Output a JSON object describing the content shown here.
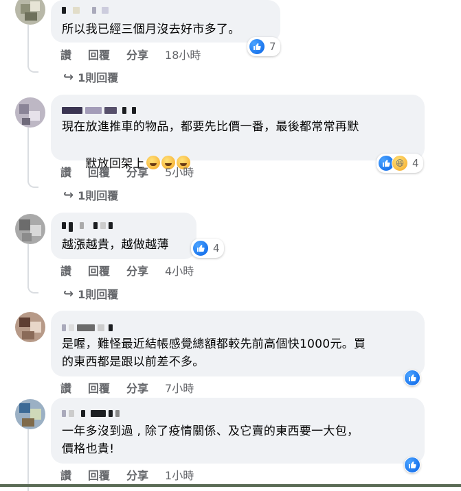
{
  "actions": {
    "like": "讚",
    "reply": "回覆",
    "share": "分享"
  },
  "comments": [
    {
      "text": "所以我已經三個月沒去好市多了。",
      "time": "18小時",
      "reactions": 7,
      "reply_link": "1則回覆",
      "reaction_types": [
        "like-icon"
      ]
    },
    {
      "text_line1": "現在放進推車的物品，都要先比價一番，最後都常常再默",
      "text_line2": "默放回架上",
      "time": "5小時",
      "reactions": 4,
      "reply_link": "1則回覆",
      "reaction_types": [
        "like-icon",
        "haha-icon"
      ],
      "inline_emoji": "rofl-emoji"
    },
    {
      "text": "越漲越貴，越做越薄",
      "time": "4小時",
      "reactions": 4,
      "reply_link": "1則回覆",
      "reaction_types": [
        "like-icon"
      ]
    },
    {
      "text_line1": "是喔，難怪最近結帳感覺總額都較先前高個快1000元。買",
      "text_line2": "的東西都是跟以前差不多。",
      "time": "7小時",
      "reaction_types": [
        "like-icon"
      ]
    },
    {
      "text_line1": "一年多沒到過 , 除了疫情關係、及它賣的東西要一大包，",
      "text_line2": "價格也貴!",
      "time": "1小時",
      "reaction_types": [
        "like-icon"
      ]
    }
  ],
  "colors": {
    "bubble": "#f0f2f5",
    "like_blue": "#1877f2",
    "meta_gray": "#65676b"
  }
}
